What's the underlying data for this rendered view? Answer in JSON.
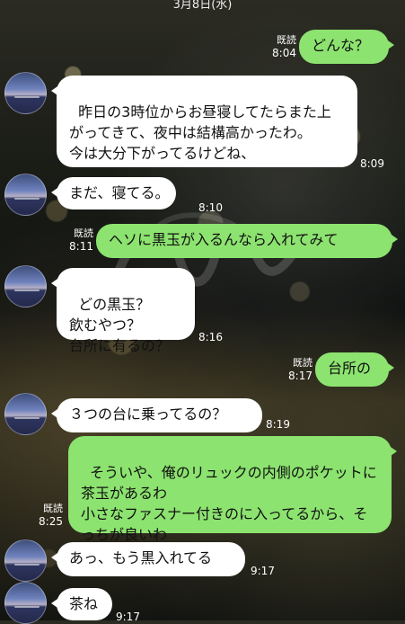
{
  "header": {
    "date": "3月8日(水)"
  },
  "read_label": "既読",
  "colors": {
    "my_bubble": "#8ce36f",
    "their_bubble": "#ffffff",
    "text": "#111111"
  },
  "messages": [
    {
      "from": "me",
      "text": "どんな？",
      "time": "8:04",
      "read": true
    },
    {
      "from": "them",
      "text": "昨日の3時位からお昼寝してたらまた上がってきて、夜中は結構高かったわ。\n今は大分下がってるけどね、",
      "time": "8:09"
    },
    {
      "from": "them",
      "text": "まだ、寝てる。",
      "time": "8:10"
    },
    {
      "from": "me",
      "text": "ヘソに黒玉が入るんなら入れてみて",
      "time": "8:11",
      "read": true
    },
    {
      "from": "them",
      "text": "どの黒玉？\n飲むやつ？\n台所に有るの？",
      "time": "8:16"
    },
    {
      "from": "me",
      "text": "台所の",
      "time": "8:17",
      "read": true
    },
    {
      "from": "them",
      "text": "３つの台に乗ってるの？",
      "time": "8:19"
    },
    {
      "from": "me",
      "text": "そういや、俺のリュックの内側のポケットに茶玉があるわ\n小さなファスナー付きのに入ってるから、そっちが良いわ",
      "time": "8:25",
      "read": true
    },
    {
      "from": "them",
      "text": "あっ、もう黒入れてる",
      "time": "9:17"
    },
    {
      "from": "them",
      "text": "茶ね",
      "time": "9:17"
    }
  ]
}
